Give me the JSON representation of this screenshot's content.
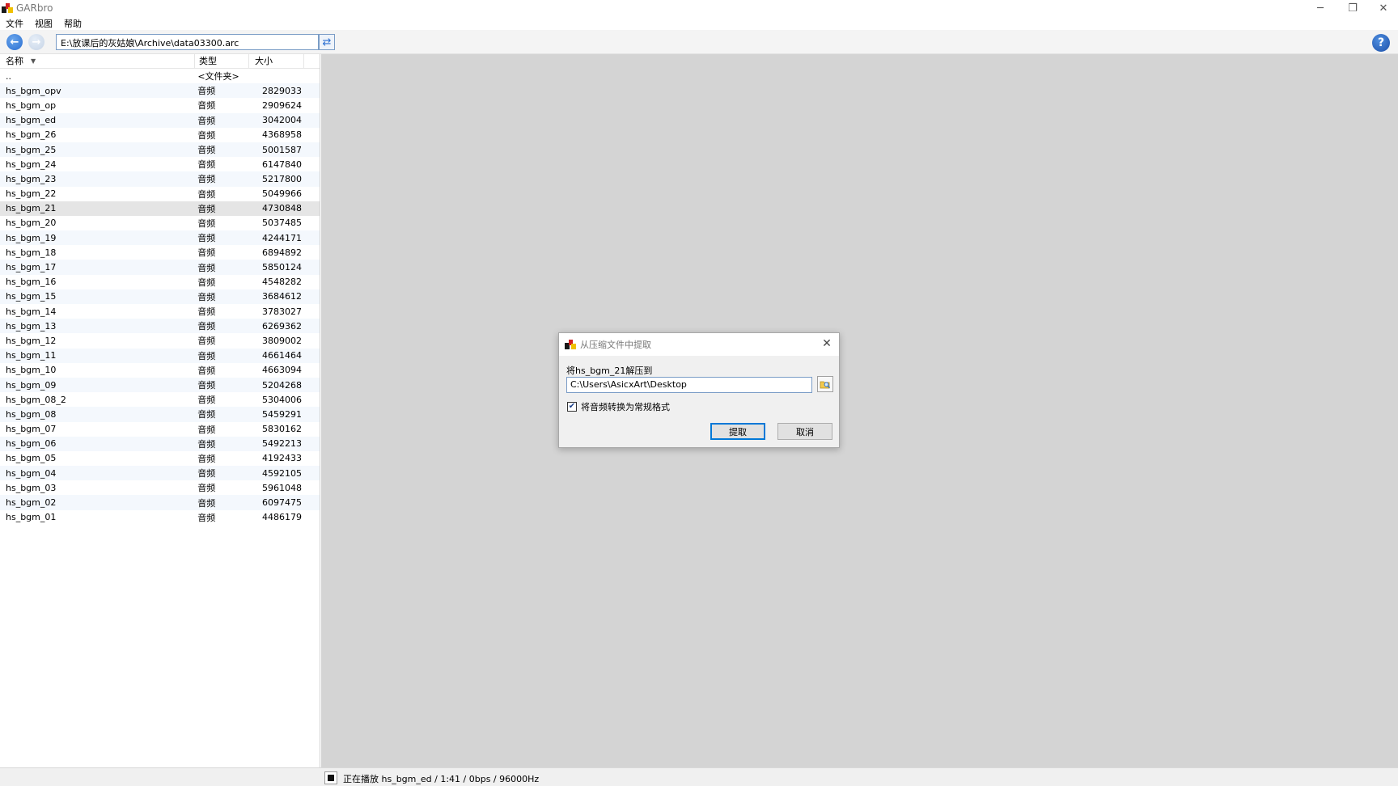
{
  "window": {
    "title": "GARbro",
    "controls": {
      "minimize": "─",
      "restore": "❐",
      "close": "✕"
    }
  },
  "menu": [
    "文件",
    "视图",
    "帮助"
  ],
  "toolbar": {
    "back_icon": "back-arrow-icon",
    "forward_icon": "forward-arrow-icon",
    "path": "E:\\放课后的灰姑娘\\Archive\\data03300.arc",
    "refresh_icon": "refresh-icon",
    "help_icon": "help-icon",
    "help_label": "?"
  },
  "file_list": {
    "headers": {
      "name": "名称",
      "type": "类型",
      "size": "大小"
    },
    "rows": [
      {
        "name": "..",
        "type": "<文件夹>",
        "size": ""
      },
      {
        "name": "hs_bgm_opv",
        "type": "音频",
        "size": "2829033"
      },
      {
        "name": "hs_bgm_op",
        "type": "音频",
        "size": "2909624"
      },
      {
        "name": "hs_bgm_ed",
        "type": "音频",
        "size": "3042004"
      },
      {
        "name": "hs_bgm_26",
        "type": "音频",
        "size": "4368958"
      },
      {
        "name": "hs_bgm_25",
        "type": "音频",
        "size": "5001587"
      },
      {
        "name": "hs_bgm_24",
        "type": "音频",
        "size": "6147840"
      },
      {
        "name": "hs_bgm_23",
        "type": "音频",
        "size": "5217800"
      },
      {
        "name": "hs_bgm_22",
        "type": "音频",
        "size": "5049966"
      },
      {
        "name": "hs_bgm_21",
        "type": "音频",
        "size": "4730848",
        "selected": true
      },
      {
        "name": "hs_bgm_20",
        "type": "音频",
        "size": "5037485"
      },
      {
        "name": "hs_bgm_19",
        "type": "音频",
        "size": "4244171"
      },
      {
        "name": "hs_bgm_18",
        "type": "音频",
        "size": "6894892"
      },
      {
        "name": "hs_bgm_17",
        "type": "音频",
        "size": "5850124"
      },
      {
        "name": "hs_bgm_16",
        "type": "音频",
        "size": "4548282"
      },
      {
        "name": "hs_bgm_15",
        "type": "音频",
        "size": "3684612"
      },
      {
        "name": "hs_bgm_14",
        "type": "音频",
        "size": "3783027"
      },
      {
        "name": "hs_bgm_13",
        "type": "音频",
        "size": "6269362"
      },
      {
        "name": "hs_bgm_12",
        "type": "音频",
        "size": "3809002"
      },
      {
        "name": "hs_bgm_11",
        "type": "音频",
        "size": "4661464"
      },
      {
        "name": "hs_bgm_10",
        "type": "音频",
        "size": "4663094"
      },
      {
        "name": "hs_bgm_09",
        "type": "音频",
        "size": "5204268"
      },
      {
        "name": "hs_bgm_08_2",
        "type": "音频",
        "size": "5304006"
      },
      {
        "name": "hs_bgm_08",
        "type": "音频",
        "size": "5459291"
      },
      {
        "name": "hs_bgm_07",
        "type": "音频",
        "size": "5830162"
      },
      {
        "name": "hs_bgm_06",
        "type": "音频",
        "size": "5492213"
      },
      {
        "name": "hs_bgm_05",
        "type": "音频",
        "size": "4192433"
      },
      {
        "name": "hs_bgm_04",
        "type": "音频",
        "size": "4592105"
      },
      {
        "name": "hs_bgm_03",
        "type": "音频",
        "size": "5961048"
      },
      {
        "name": "hs_bgm_02",
        "type": "音频",
        "size": "6097475"
      },
      {
        "name": "hs_bgm_01",
        "type": "音频",
        "size": "4486179"
      }
    ]
  },
  "status": {
    "text": "正在播放 hs_bgm_ed / 1:41 / 0bps / 96000Hz",
    "stop_icon": "stop-icon"
  },
  "dialog": {
    "title": "从压缩文件中提取",
    "label": "将hs_bgm_21解压到",
    "destination": "C:\\Users\\AsicxArt\\Desktop",
    "browse_icon": "folder-browse-icon",
    "checkbox_label": "将音频转换为常规格式",
    "checkbox_checked": true,
    "checkmark": "✔",
    "extract_button": "提取",
    "cancel_button": "取消",
    "close_icon": "✕"
  },
  "colors": {
    "accent": "#0078d7",
    "selection": "#e5e5e5",
    "preview_bg": "#d4d4d4",
    "row_alt": "#f4f8fd"
  }
}
